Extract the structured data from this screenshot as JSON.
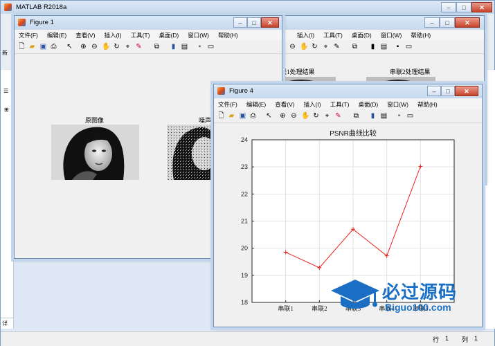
{
  "main": {
    "title": "MATLAB R2018a",
    "statusbar": {
      "row_label": "行",
      "row_value": "1",
      "col_label": "列",
      "col_value": "1"
    },
    "left_fragments": [
      "新",
      "详"
    ]
  },
  "figure1": {
    "title": "Figure 1",
    "menu": [
      "文件(F)",
      "编辑(E)",
      "查看(V)",
      "插入(I)",
      "工具(T)",
      "桌面(D)",
      "窗口(W)",
      "帮助(H)"
    ],
    "subplot_titles": [
      "原图像",
      "噪声"
    ]
  },
  "figure_back": {
    "menu": [
      "插入(I)",
      "工具(T)",
      "桌面(D)",
      "窗口(W)",
      "帮助(H)"
    ],
    "subplot_titles": [
      "联1处理结果",
      "串联2处理结果"
    ]
  },
  "figure4": {
    "title": "Figure 4",
    "menu": [
      "文件(F)",
      "编辑(E)",
      "查看(V)",
      "插入(I)",
      "工具(T)",
      "桌面(D)",
      "窗口(W)",
      "帮助(H)"
    ]
  },
  "chart_data": {
    "type": "line",
    "title": "PSNR曲线比较",
    "xlabel": "",
    "ylabel": "",
    "categories": [
      "串联1",
      "串联2",
      "串联3",
      "串联4",
      "串联5"
    ],
    "tick_labels": [
      "串联1",
      "串联2",
      "串联3",
      "串联4",
      "串联5"
    ],
    "series": [
      {
        "values": [
          19.85,
          19.28,
          20.7,
          19.72,
          23.02
        ],
        "color": "#e8201c",
        "marker": "+"
      }
    ],
    "ylim": [
      18,
      24
    ],
    "yticks": [
      18,
      19,
      20,
      21,
      22,
      23,
      24
    ],
    "grid": true
  },
  "watermark": {
    "brand": "必过源码",
    "site": "Biguo100.com"
  },
  "colors": {
    "titlebar": "#c7d9ee",
    "window_bg": "#f0f0f0",
    "line": "#e8201c",
    "watermark": "#1a6fc4"
  },
  "icons": [
    "new-file-icon",
    "open-folder-icon",
    "save-icon",
    "print-icon",
    "pointer-icon",
    "zoom-in-icon",
    "zoom-out-icon",
    "pan-icon",
    "rotate-icon",
    "data-cursor-icon",
    "brush-icon",
    "link-plot-icon",
    "colorbar-icon",
    "legend-icon",
    "hide-tools-icon",
    "dock-icon"
  ]
}
